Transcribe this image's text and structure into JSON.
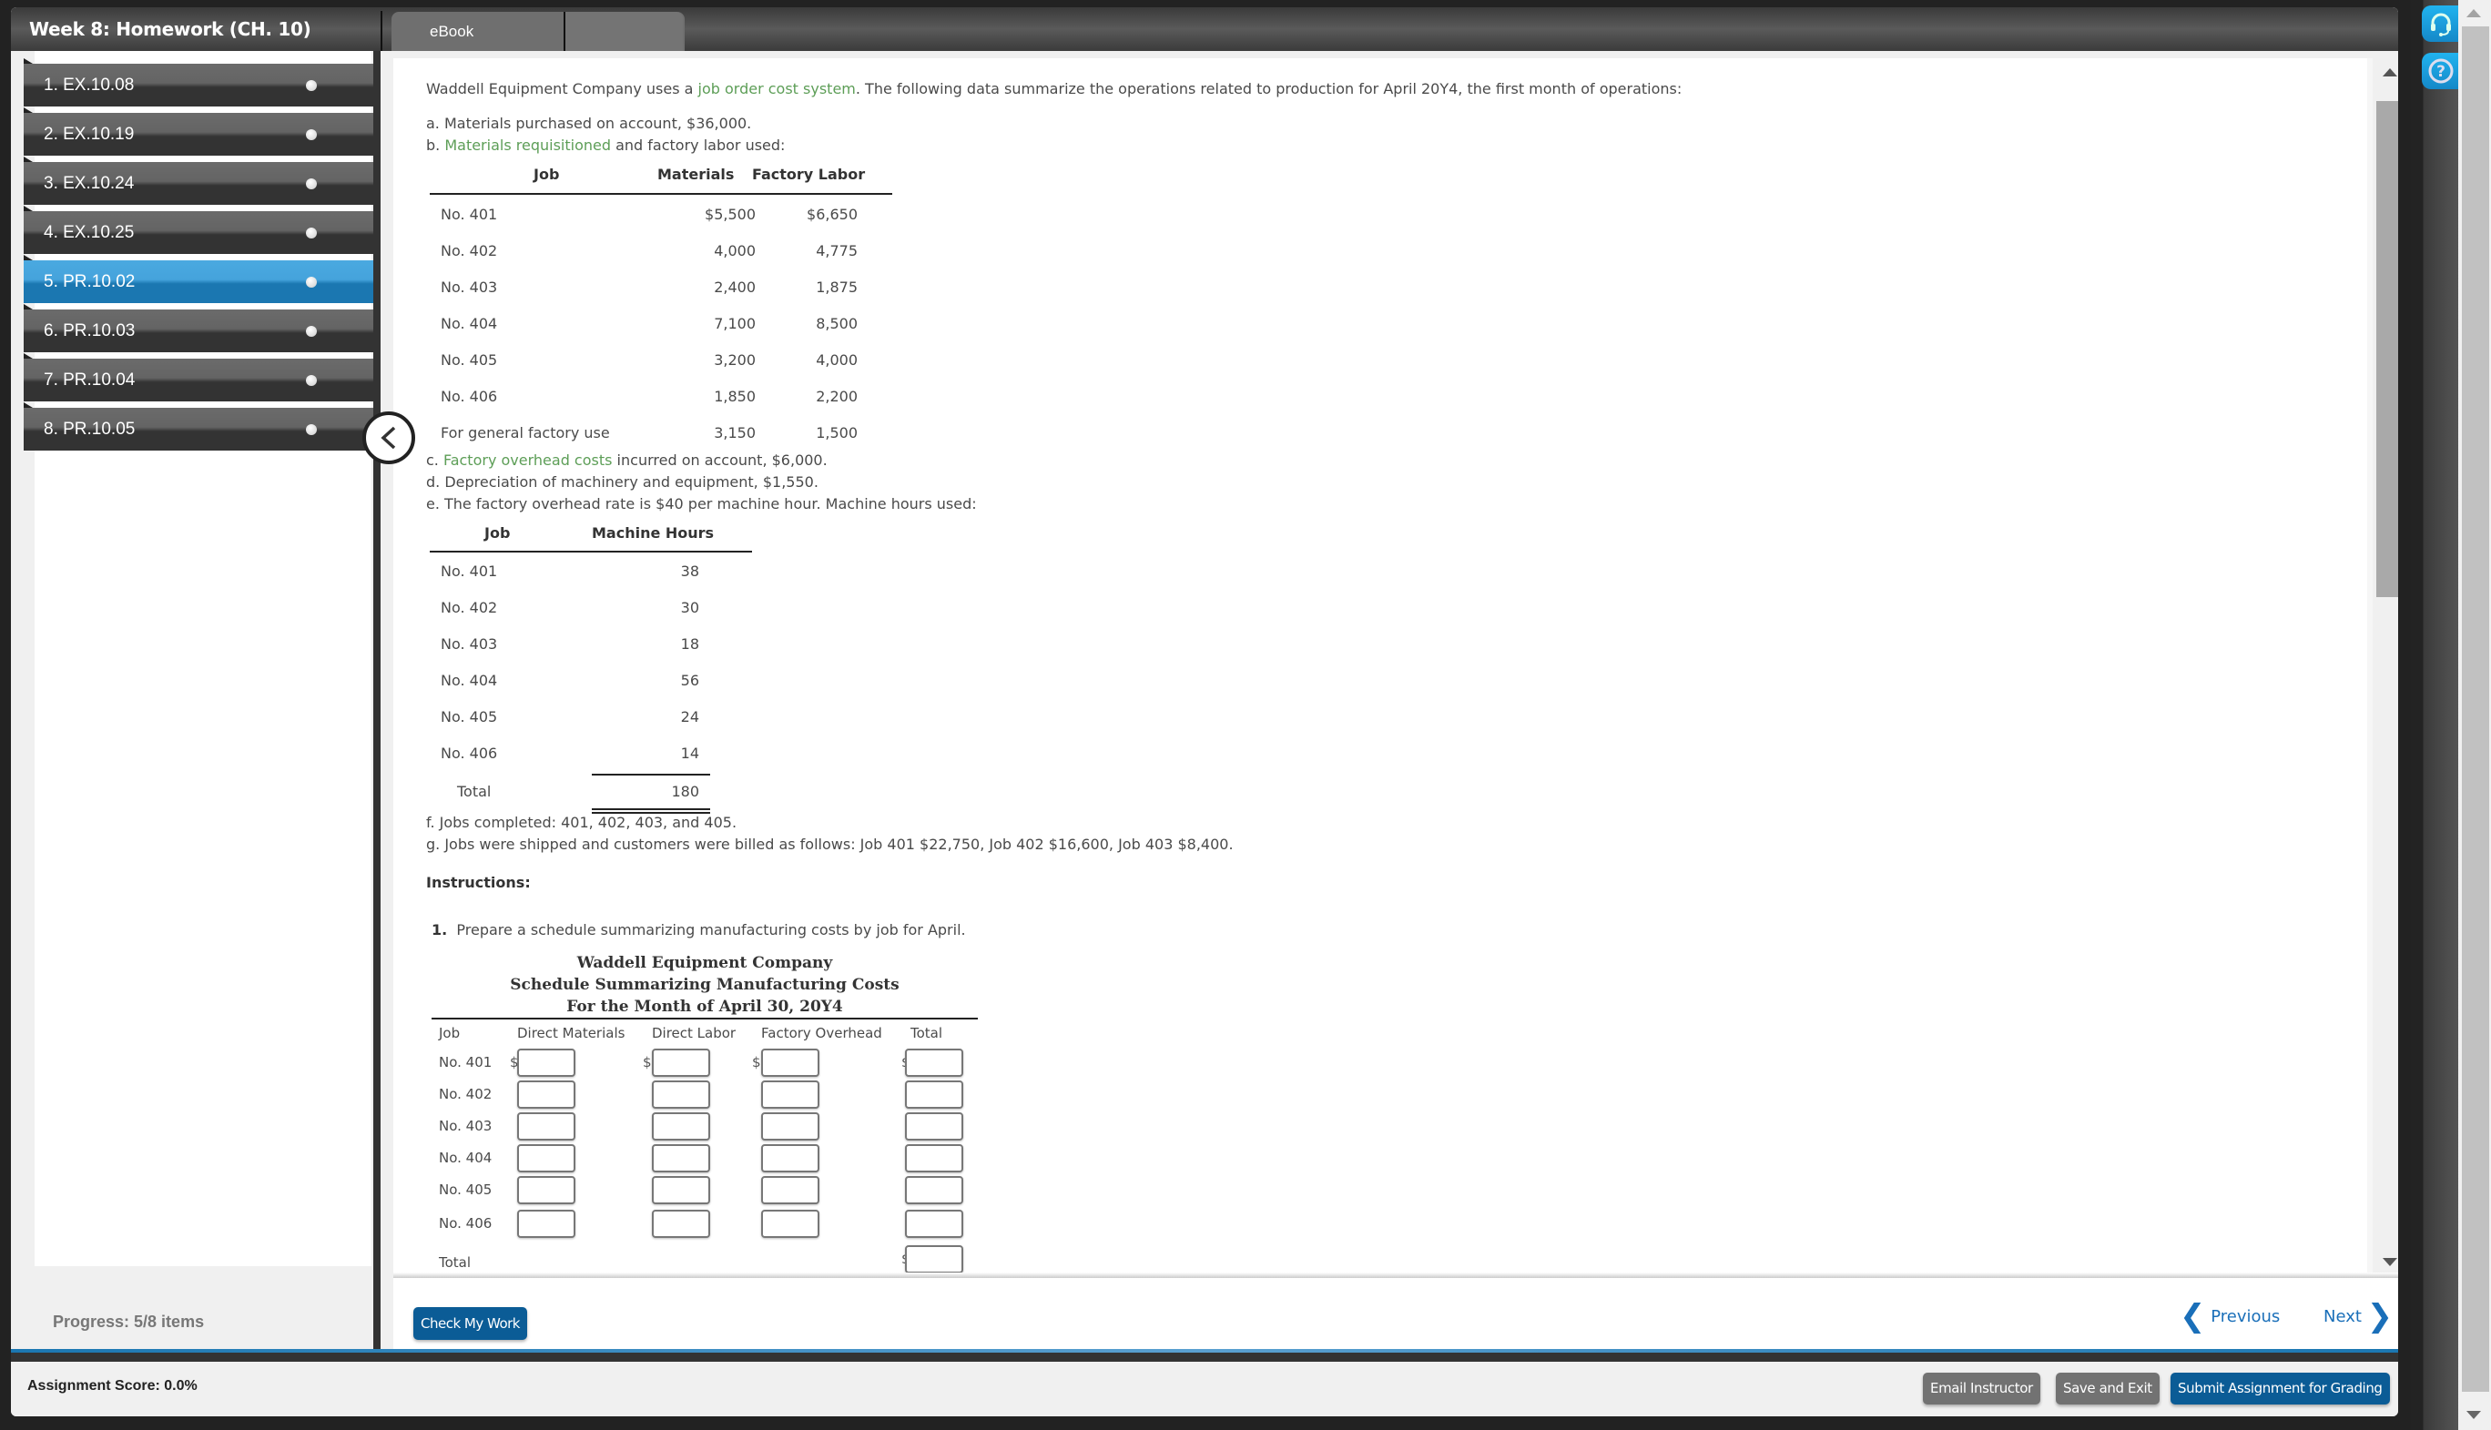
{
  "header": {
    "course_title": "Week 8: Homework (CH. 10)",
    "tabs": [
      {
        "label": "eBook"
      },
      {
        "label": ""
      }
    ]
  },
  "sidebar": {
    "items": [
      {
        "label": "1. EX.10.08",
        "active": false
      },
      {
        "label": "2. EX.10.19",
        "active": false
      },
      {
        "label": "3. EX.10.24",
        "active": false
      },
      {
        "label": "4. EX.10.25",
        "active": false
      },
      {
        "label": "5. PR.10.02",
        "active": true
      },
      {
        "label": "6. PR.10.03",
        "active": false
      },
      {
        "label": "7. PR.10.04",
        "active": false
      },
      {
        "label": "8. PR.10.05",
        "active": false
      }
    ],
    "progress": "Progress:  5/8 items"
  },
  "problem": {
    "intro_before": "Waddell Equipment Company uses a ",
    "intro_link": "job order cost system",
    "intro_after": ". The following data summarize the operations related to production for April 20Y4, the first month of operations:",
    "item_a": "a. Materials purchased on account, $36,000.",
    "item_b_prefix": "b. ",
    "item_b_link": "Materials requisitioned",
    "item_b_after": " and factory labor used:",
    "materials_table": {
      "headers": [
        "Job",
        "Materials",
        "Factory Labor"
      ],
      "rows": [
        {
          "job": "No. 401",
          "materials": "$5,500",
          "labor": "$6,650"
        },
        {
          "job": "No. 402",
          "materials": "4,000",
          "labor": "4,775"
        },
        {
          "job": "No. 403",
          "materials": "2,400",
          "labor": "1,875"
        },
        {
          "job": "No. 404",
          "materials": "7,100",
          "labor": "8,500"
        },
        {
          "job": "No. 405",
          "materials": "3,200",
          "labor": "4,000"
        },
        {
          "job": "No. 406",
          "materials": "1,850",
          "labor": "2,200"
        },
        {
          "job": "For general factory use",
          "materials": "3,150",
          "labor": "1,500"
        }
      ]
    },
    "item_c_prefix": "c. ",
    "item_c_link": "Factory overhead costs",
    "item_c_after": " incurred on account, $6,000.",
    "item_d": "d. Depreciation of machinery and equipment, $1,550.",
    "item_e": "e. The factory overhead rate is $40 per machine hour. Machine hours used:",
    "hours_table": {
      "headers": [
        "Job",
        "Machine Hours"
      ],
      "rows": [
        {
          "job": "No. 401",
          "hours": "38"
        },
        {
          "job": "No. 402",
          "hours": "30"
        },
        {
          "job": "No. 403",
          "hours": "18"
        },
        {
          "job": "No. 404",
          "hours": "56"
        },
        {
          "job": "No. 405",
          "hours": "24"
        },
        {
          "job": "No. 406",
          "hours": "14"
        }
      ],
      "total_label": "Total",
      "total_value": "180"
    },
    "item_f": "f. Jobs completed: 401, 402, 403, and 405.",
    "item_g": "g. Jobs were shipped and customers were billed as follows: Job 401 $22,750, Job 402 $16,600, Job 403 $8,400.",
    "instructions_label": "Instructions:",
    "step_number": "1.",
    "step_text": "Prepare a schedule summarizing manufacturing costs by job for April."
  },
  "schedule": {
    "company": "Waddell Equipment Company",
    "title": "Schedule Summarizing Manufacturing Costs",
    "period": "For the Month of April 30, 20Y4",
    "columns": [
      "Job",
      "Direct Materials",
      "Direct Labor",
      "Factory Overhead",
      "Total"
    ],
    "rows": [
      {
        "job": "No. 401",
        "direct_materials": "",
        "direct_labor": "",
        "factory_overhead": "",
        "total": ""
      },
      {
        "job": "No. 402",
        "direct_materials": "",
        "direct_labor": "",
        "factory_overhead": "",
        "total": ""
      },
      {
        "job": "No. 403",
        "direct_materials": "",
        "direct_labor": "",
        "factory_overhead": "",
        "total": ""
      },
      {
        "job": "No. 404",
        "direct_materials": "",
        "direct_labor": "",
        "factory_overhead": "",
        "total": ""
      },
      {
        "job": "No. 405",
        "direct_materials": "",
        "direct_labor": "",
        "factory_overhead": "",
        "total": ""
      },
      {
        "job": "No. 406",
        "direct_materials": "",
        "direct_labor": "",
        "factory_overhead": "",
        "total": ""
      }
    ],
    "total_label": "Total",
    "grand_total": "",
    "currency_symbol": "$"
  },
  "footer": {
    "check_my_work": "Check My Work",
    "previous": "Previous",
    "next": "Next"
  },
  "bottombar": {
    "assignment_score": "Assignment Score:  0.0%",
    "email_instructor": "Email Instructor",
    "save_and_exit": "Save and Exit",
    "submit": "Submit Assignment for Grading"
  },
  "colors": {
    "accent_blue": "#0b5c96",
    "active_nav": "#1b77b1",
    "link_green": "#5d9e57",
    "help_icon_blue": "#1a9fdd"
  }
}
